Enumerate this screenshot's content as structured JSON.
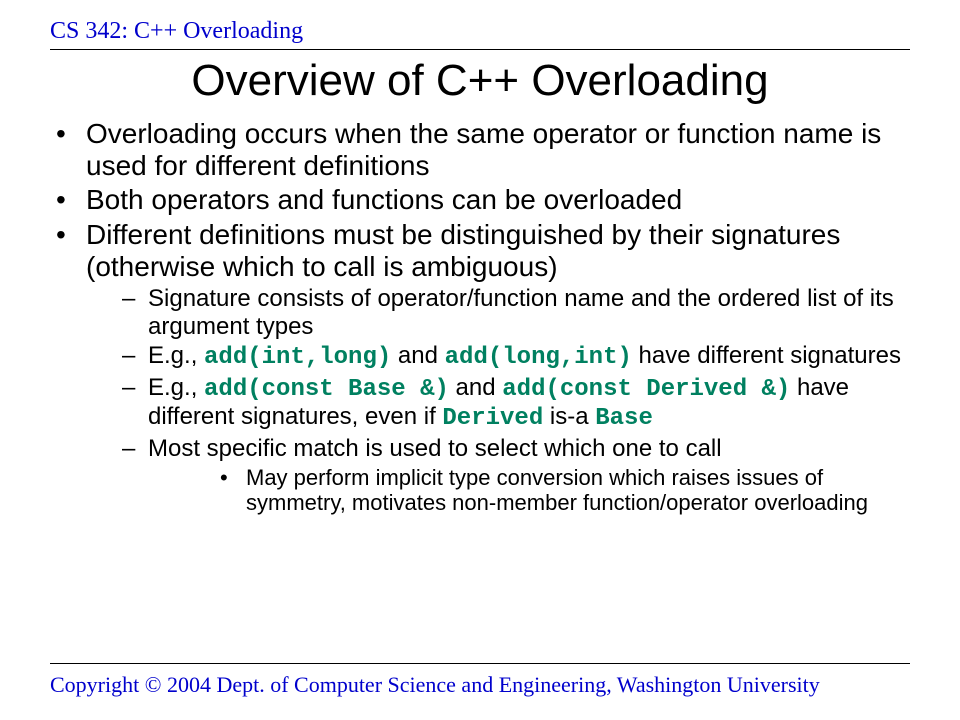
{
  "header": "CS 342: C++ Overloading",
  "title": "Overview of C++ Overloading",
  "bullets": {
    "b1": "Overloading occurs when the same operator or function name is used for different definitions",
    "b2": "Both operators and functions can be overloaded",
    "b3": "Different definitions must be distinguished by their signatures (otherwise which to call is ambiguous)",
    "s1": "Signature consists of operator/function name and the ordered list of its argument types",
    "s2_pre": "E.g., ",
    "s2_code1": "add(int,long)",
    "s2_mid": " and ",
    "s2_code2": "add(long,int)",
    "s2_post": " have different signatures",
    "s3_pre": "E.g., ",
    "s3_code1": "add(const Base &)",
    "s3_mid": " and ",
    "s3_code2": "add(const Derived &)",
    "s3_post1": " have different signatures, even if ",
    "s3_code3": "Derived",
    "s3_post2": " is-a ",
    "s3_code4": "Base",
    "s4": "Most specific match is used to select which one to call",
    "ss1": "May perform implicit type conversion which raises issues of symmetry, motivates non-member function/operator overloading"
  },
  "footer": "Copyright © 2004 Dept. of Computer Science and Engineering, Washington University"
}
